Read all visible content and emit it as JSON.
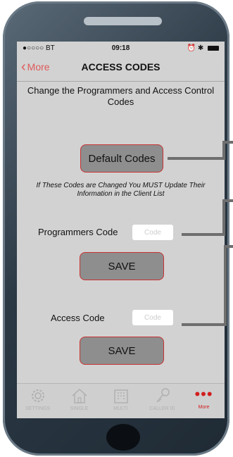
{
  "status_bar": {
    "carrier": "●○○○○ BT",
    "time": "09:18",
    "right_icons": "⏰ ✱"
  },
  "nav": {
    "back_label": "More",
    "title": "ACCESS CODES"
  },
  "description": "Change the Programmers and Access Control Codes",
  "default_button": "Default Codes",
  "warning": "If These Codes are Changed You MUST Update Their Information in the Client List",
  "programmers": {
    "label": "Programmers Code",
    "placeholder": "Code",
    "save_label": "SAVE"
  },
  "access": {
    "label": "Access Code",
    "placeholder": "Code",
    "save_label": "SAVE"
  },
  "tabs": [
    {
      "label": "SETTINGS",
      "icon": "gear-icon"
    },
    {
      "label": "SINGLE",
      "icon": "house-icon"
    },
    {
      "label": "MULTI",
      "icon": "building-icon"
    },
    {
      "label": "CALLER ID",
      "icon": "key-icon"
    },
    {
      "label": "More",
      "icon": "more-dots-icon",
      "active": true
    }
  ],
  "colors": {
    "accent": "#d21e1e",
    "button_border": "#c83232",
    "background": "#d2d2d2",
    "button_fill": "#8e8e8e"
  }
}
